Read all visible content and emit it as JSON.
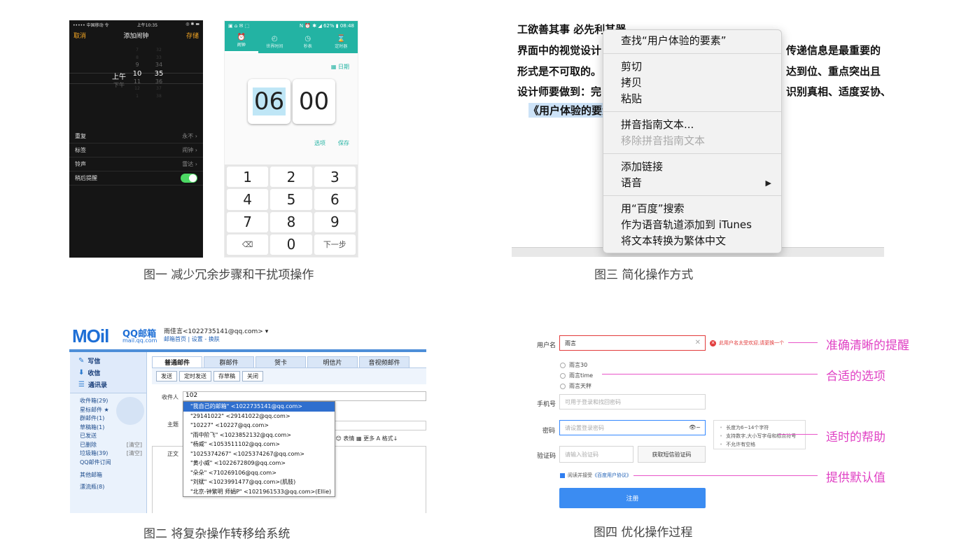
{
  "captions": {
    "fig1": "图一 减少冗余步骤和干扰项操作",
    "fig2": "图二 将复杂操作转移给系统",
    "fig3": "图三  简化操作方式",
    "fig4": "图四  优化操作过程"
  },
  "ios_alarm": {
    "status_left": "••••• 中国移动 令",
    "status_time": "上午10:35",
    "status_right": "◎ ✱ ▬",
    "cancel": "取消",
    "title": "添加闹钟",
    "save": "存储",
    "ampm": [
      "上午",
      "下午"
    ],
    "hours": [
      "7",
      "8",
      "9",
      "10",
      "11",
      "12",
      "1"
    ],
    "minutes": [
      "32",
      "33",
      "34",
      "35",
      "36",
      "37",
      "38"
    ],
    "rows": [
      {
        "label": "重复",
        "value": "永不 ›"
      },
      {
        "label": "标签",
        "value": "闹钟 ›"
      },
      {
        "label": "铃声",
        "value": "雷达 ›"
      },
      {
        "label": "稍后提醒",
        "value": ""
      }
    ]
  },
  "android_alarm": {
    "status_left": "▣ ⌂ ✉ ⬚",
    "status_right": "N ⏰ ✱ ◢ 62% ▮ 08:48",
    "tabs": [
      {
        "icon": "⏰",
        "label": "闹钟"
      },
      {
        "icon": "◴",
        "label": "世界时间"
      },
      {
        "icon": "◷",
        "label": "秒表"
      },
      {
        "icon": "⌛",
        "label": "定时器"
      }
    ],
    "date_button": "▦ 日期",
    "hour": "06",
    "minute": "00",
    "options": "选项",
    "save": "保存",
    "keys": [
      "1",
      "2",
      "3",
      "4",
      "5",
      "6",
      "7",
      "8",
      "9",
      "⌫",
      "0",
      "下一步"
    ]
  },
  "mac_menu": {
    "bg_lines": [
      "工欲善其事 必先利其器",
      "界面中的视觉设计",
      "形式是不可取的。",
      "设计师要做到：完",
      "《用户体验的要素"
    ],
    "bg_lines_right": [
      "传递信息是最重要的",
      "达到位、重点突出且",
      "识别真相、适度妥协、"
    ],
    "items": [
      [
        {
          "label": "查找“用户体验的要素”",
          "disabled": false
        }
      ],
      [
        {
          "label": "剪切",
          "disabled": false
        },
        {
          "label": "拷贝",
          "disabled": false
        },
        {
          "label": "粘贴",
          "disabled": false
        }
      ],
      [
        {
          "label": "拼音指南文本...",
          "disabled": false
        },
        {
          "label": "移除拼音指南文本",
          "disabled": true
        }
      ],
      [
        {
          "label": "添加链接",
          "disabled": false
        },
        {
          "label": "语音",
          "disabled": false,
          "submenu": true
        }
      ],
      [
        {
          "label": "用“百度”搜索",
          "disabled": false
        },
        {
          "label": "作为语音轨道添加到 iTunes",
          "disabled": false
        },
        {
          "label": "将文本转换为繁体中文",
          "disabled": false
        }
      ]
    ],
    "submenu_arrow": "▶"
  },
  "qq_mail": {
    "logo": "MOil",
    "brand": "QQ邮箱",
    "brand_url": "mail.qq.com",
    "user": "雨佳言<1022735141@qq.com> ▾",
    "user_links": "邮箱首页 | 设置 - 换肤",
    "side_buttons": [
      {
        "icon": "✎",
        "label": "写信"
      },
      {
        "icon": "⬇",
        "label": "收信"
      },
      {
        "icon": "☰",
        "label": "通讯录"
      }
    ],
    "folders": [
      {
        "label": "收件箱(29)",
        "extra": ""
      },
      {
        "label": "星标邮件 ★",
        "extra": ""
      },
      {
        "label": "群邮件(1)",
        "extra": ""
      },
      {
        "label": "草稿箱(1)",
        "extra": ""
      },
      {
        "label": "已发送",
        "extra": ""
      },
      {
        "label": "已删除",
        "extra": "[清空]"
      },
      {
        "label": "垃圾箱(39)",
        "extra": "[清空]"
      },
      {
        "label": "QQ邮件订阅",
        "extra": ""
      },
      {
        "label": "其他邮箱",
        "extra": ""
      },
      {
        "label": "漂流瓶(8)",
        "extra": ""
      }
    ],
    "tabs": [
      "普通邮件",
      "群邮件",
      "贺卡",
      "明信片",
      "音视频邮件"
    ],
    "toolbar": [
      "发送",
      "定时发送",
      "存草稿",
      "关闭"
    ],
    "labels": {
      "to": "收件人",
      "subject": "主题",
      "body": "正文"
    },
    "to_value": "102",
    "format_bar": "蓉  😊 表情  ▦ 更多   A 格式↓",
    "suggestions": [
      "\"我自己的邮箱\" <1022735141@qq.com>",
      "\"29141022\" <29141022@qq.com>",
      "\"10227\" <10227@qq.com>",
      "\"雨中阶飞\" <1023852132@qq.com>",
      "\"杨威\" <1053511102@qq.com>",
      "\"1025374267\" <1025374267@qq.com>",
      "\"黄小威\" <1022672809@qq.com>",
      "\"朵朵\" <710269106@qq.com>",
      "\"刘斌\" <1023991477@qq.com>(肌肢)",
      "\"北京-钟繁明 师娟P\" <1021961533@qq.com>(Ellie)"
    ]
  },
  "register_form": {
    "labels": {
      "username": "用户名",
      "phone": "手机号",
      "password": "密码",
      "captcha": "验证码"
    },
    "username_value": "雨言",
    "clear_icon": "✕",
    "error": "此用户名太受欢迎,请更换一个",
    "radio_options": [
      "雨言30",
      "雨言time",
      "雨言天秤"
    ],
    "phone_placeholder": "可用于登录和找回密码",
    "password_placeholder": "请设置登录密码",
    "eye_icon": "👁~",
    "password_tips": [
      "长度为6~14个字符",
      "支持数字,大小写字母和标点符号",
      "不允许有空格"
    ],
    "captcha_placeholder": "请输入验证码",
    "sms_button": "获取短信验证码",
    "agree_prefix": "阅读并接受",
    "agree_link": "《百度用户协议》",
    "submit": "注册",
    "annotations": [
      "准确清晰的提醒",
      "合适的选项",
      "适时的帮助",
      "提供默认值"
    ],
    "colors": {
      "annotation": "#e041c4",
      "error": "#e23b3b",
      "primary": "#3b8cf2"
    }
  }
}
